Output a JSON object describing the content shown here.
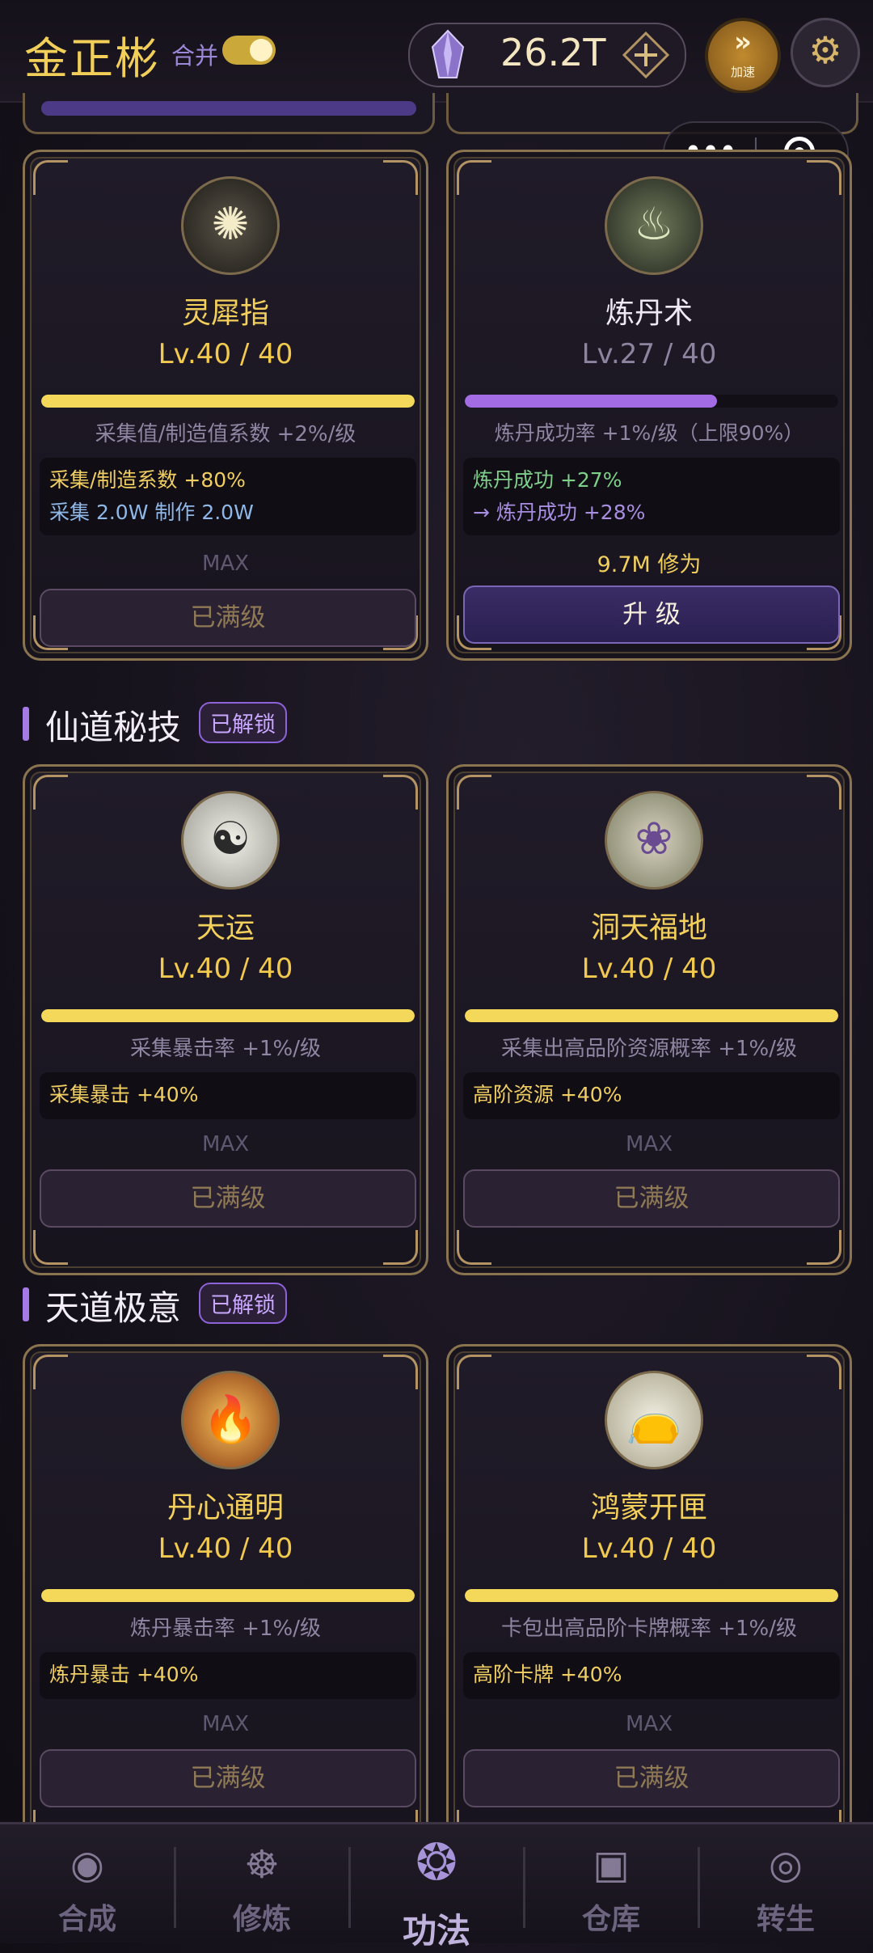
{
  "header": {
    "player_name": "金正彬",
    "merge_label": "合并",
    "merge_enabled": true,
    "currency_value": "26.2T",
    "speed_label": "加速"
  },
  "sections": [
    {
      "title": "仙道秘技",
      "badge": "已解锁"
    },
    {
      "title": "天道极意",
      "badge": "已解锁"
    }
  ],
  "cards": [
    {
      "name": "灵犀指",
      "level": "Lv.40 / 40",
      "progress": 1.0,
      "desc": "采集值/制造值系数 +2%/级",
      "effects": [
        "采集/制造系数 +80%",
        "采集 2.0W  制作 2.0W"
      ],
      "max": "MAX",
      "button": "已满级"
    },
    {
      "name": "炼丹术",
      "level": "Lv.27 / 40",
      "progress": 0.675,
      "desc": "炼丹成功率 +1%/级（上限90%）",
      "effects": [
        "炼丹成功 +27%",
        "→ 炼丹成功 +28%"
      ],
      "cost": "9.7M 修为",
      "button": "升 级"
    },
    {
      "name": "天运",
      "level": "Lv.40 / 40",
      "progress": 1.0,
      "desc": "采集暴击率 +1%/级",
      "effects": [
        "采集暴击 +40%"
      ],
      "max": "MAX",
      "button": "已满级"
    },
    {
      "name": "洞天福地",
      "level": "Lv.40 / 40",
      "progress": 1.0,
      "desc": "采集出高品阶资源概率 +1%/级",
      "effects": [
        "高阶资源 +40%"
      ],
      "max": "MAX",
      "button": "已满级"
    },
    {
      "name": "丹心通明",
      "level": "Lv.40 / 40",
      "progress": 1.0,
      "desc": "炼丹暴击率 +1%/级",
      "effects": [
        "炼丹暴击 +40%"
      ],
      "max": "MAX",
      "button": "已满级"
    },
    {
      "name": "鸿蒙开匣",
      "level": "Lv.40 / 40",
      "progress": 1.0,
      "desc": "卡包出高品阶卡牌概率 +1%/级",
      "effects": [
        "高阶卡牌 +40%"
      ],
      "max": "MAX",
      "button": "已满级"
    }
  ],
  "nav": [
    {
      "label": "合成",
      "icon": "synthesis-icon"
    },
    {
      "label": "修炼",
      "icon": "meditation-icon"
    },
    {
      "label": "功法",
      "icon": "technique-icon",
      "active": true
    },
    {
      "label": "仓库",
      "icon": "warehouse-icon"
    },
    {
      "label": "转生",
      "icon": "rebirth-icon"
    }
  ]
}
